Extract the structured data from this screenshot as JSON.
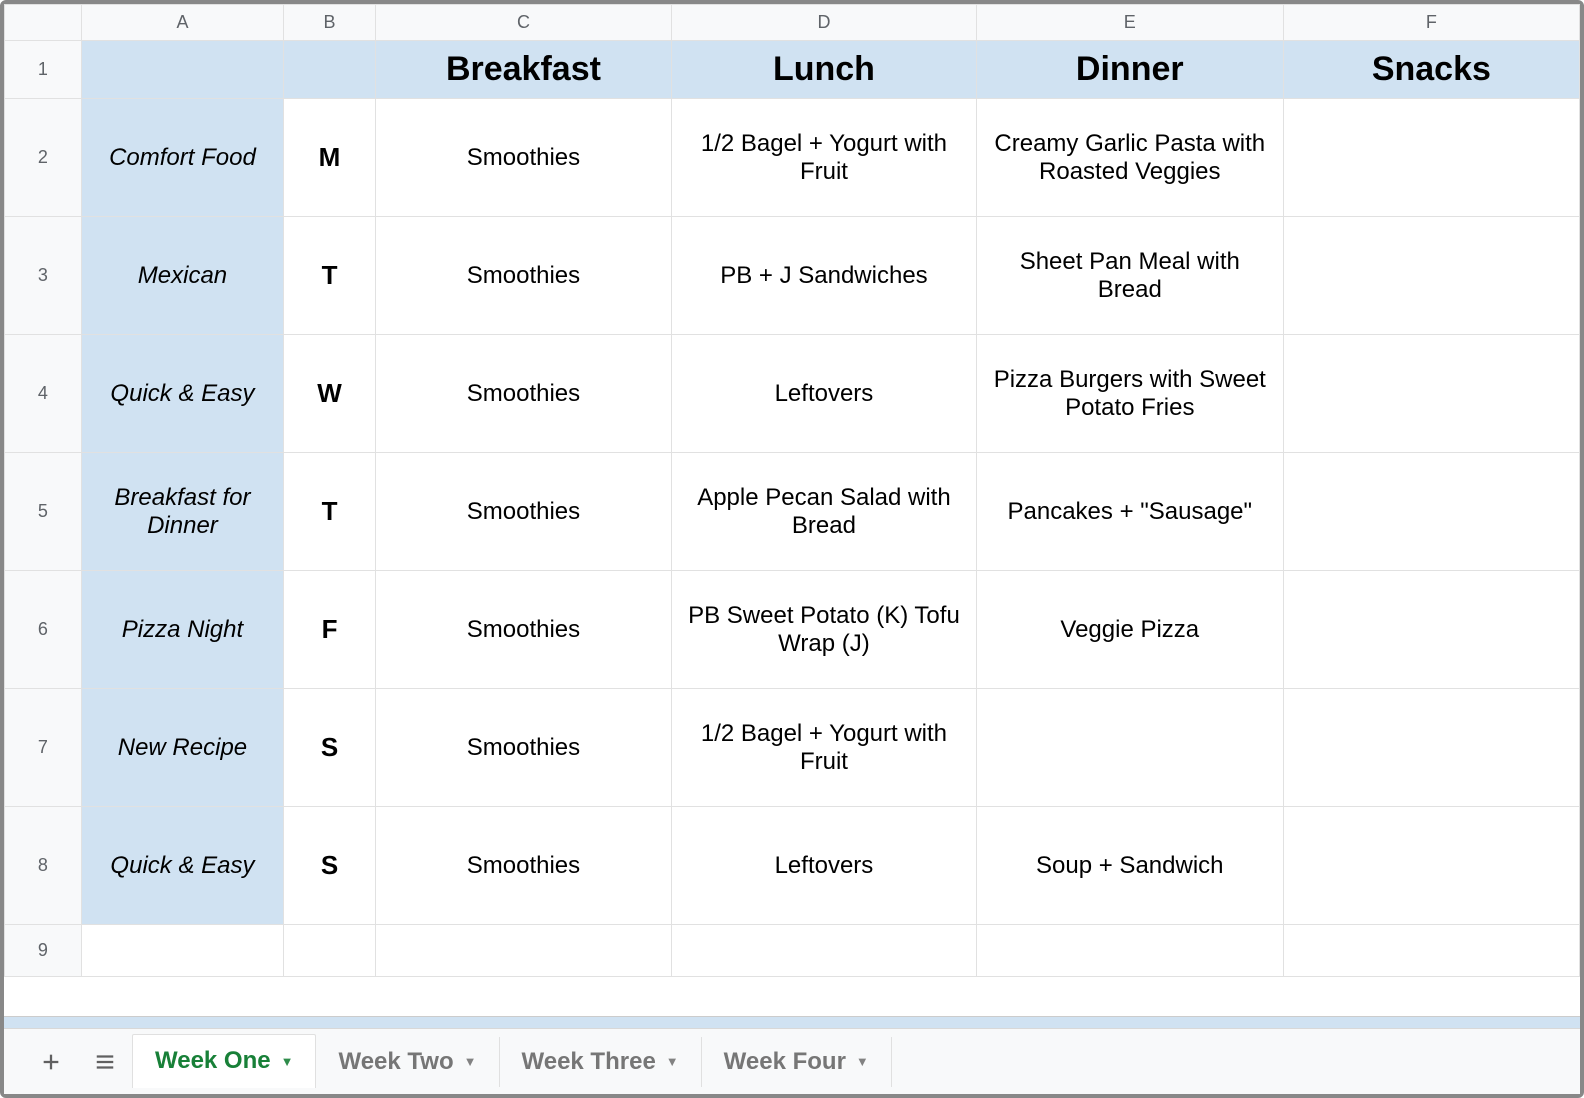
{
  "columns": [
    "A",
    "B",
    "C",
    "D",
    "E",
    "F"
  ],
  "headers": {
    "A": "",
    "B": "",
    "C": "Breakfast",
    "D": "Lunch",
    "E": "Dinner",
    "F": "Snacks"
  },
  "rows": [
    {
      "num": "2",
      "theme": "Comfort Food",
      "day": "M",
      "breakfast": "Smoothies",
      "lunch": "1/2 Bagel + Yogurt with Fruit",
      "dinner": "Creamy Garlic Pasta with Roasted Veggies",
      "snacks": ""
    },
    {
      "num": "3",
      "theme": "Mexican",
      "day": "T",
      "breakfast": "Smoothies",
      "lunch": "PB + J Sandwiches",
      "dinner": "Sheet Pan Meal with Bread",
      "snacks": ""
    },
    {
      "num": "4",
      "theme": "Quick & Easy",
      "day": "W",
      "breakfast": "Smoothies",
      "lunch": "Leftovers",
      "dinner": "Pizza Burgers with Sweet Potato Fries",
      "snacks": ""
    },
    {
      "num": "5",
      "theme": "Breakfast for Dinner",
      "day": "T",
      "breakfast": "Smoothies",
      "lunch": "Apple Pecan Salad with Bread",
      "dinner": "Pancakes + \"Sausage\"",
      "snacks": ""
    },
    {
      "num": "6",
      "theme": "Pizza Night",
      "day": "F",
      "breakfast": "Smoothies",
      "lunch": "PB Sweet Potato (K) Tofu Wrap (J)",
      "dinner": "Veggie Pizza",
      "snacks": ""
    },
    {
      "num": "7",
      "theme": "New Recipe",
      "day": "S",
      "breakfast": "Smoothies",
      "lunch": "1/2 Bagel + Yogurt with Fruit",
      "dinner": "",
      "snacks": ""
    },
    {
      "num": "8",
      "theme": "Quick & Easy",
      "day": "S",
      "breakfast": "Smoothies",
      "lunch": "Leftovers",
      "dinner": "Soup + Sandwich",
      "snacks": ""
    }
  ],
  "row_header_1": "1",
  "row_blank_9": "9",
  "tabs": [
    {
      "label": "Week One",
      "active": true
    },
    {
      "label": "Week Two",
      "active": false
    },
    {
      "label": "Week Three",
      "active": false
    },
    {
      "label": "Week Four",
      "active": false
    }
  ]
}
